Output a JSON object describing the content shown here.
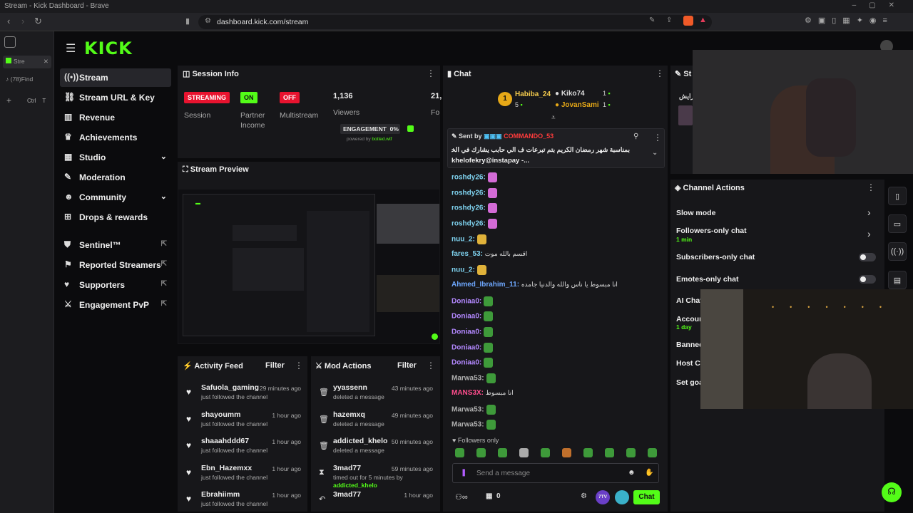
{
  "browser": {
    "title": "Stream - Kick Dashboard - Brave",
    "url": "dashboard.kick.com/stream",
    "tabs": [
      {
        "label": "Stre"
      },
      {
        "label": "(78)Find"
      }
    ],
    "tab_shortcut_a": "Ctrl",
    "tab_shortcut_b": "T"
  },
  "brand": {
    "logo": "KICK",
    "accent": "#53fc18"
  },
  "sidebar": {
    "items": [
      {
        "label": "Stream",
        "icon": "broadcast-icon"
      },
      {
        "label": "Stream URL & Key",
        "icon": "link-icon"
      },
      {
        "label": "Revenue",
        "icon": "chart-icon"
      },
      {
        "label": "Achievements",
        "icon": "trophy-icon"
      },
      {
        "label": "Studio",
        "icon": "studio-icon"
      },
      {
        "label": "Moderation",
        "icon": "wrench-icon"
      },
      {
        "label": "Community",
        "icon": "people-icon"
      },
      {
        "label": "Drops & rewards",
        "icon": "drops-icon"
      },
      {
        "label": "Sentinel™",
        "icon": "shield-icon"
      },
      {
        "label": "Reported Streamers",
        "icon": "flag-icon"
      },
      {
        "label": "Supporters",
        "icon": "heart-icon"
      },
      {
        "label": "Engagement PvP",
        "icon": "swords-icon"
      }
    ]
  },
  "session": {
    "title": "Session Info",
    "status": "STREAMING",
    "partner": "ON",
    "multistream": "OFF",
    "viewers": "1,136",
    "col5": "21,",
    "labels": {
      "session": "Session",
      "partner_a": "Partner",
      "partner_b": "Income",
      "multistream": "Multistream",
      "viewers": "Viewers",
      "col5": "Fo"
    },
    "engagement_label": "ENGAGEMENT",
    "engagement_value": "0%",
    "powered": "powered by",
    "botted": "botted.wtf"
  },
  "preview": {
    "title": "Stream Preview"
  },
  "chat": {
    "title": "Chat",
    "top_gifters": [
      {
        "rank": "1",
        "name": "Habiba_24",
        "count": "5"
      },
      {
        "name": "Kiko74",
        "count": "1"
      },
      {
        "name": "JovanSami",
        "count": "1"
      }
    ],
    "pinned": {
      "sent_by": "Sent by",
      "sender": "COMMANDO_53",
      "text": "بمناسبة شهر رمضان الكريم بتم تبرعات ف الي حابب يشارك في الخير من هنا",
      "text2": "khelofekry@instapay -..."
    },
    "messages": [
      {
        "user": "roshdy26:",
        "text": "",
        "color": "#7fd3f0"
      },
      {
        "user": "roshdy26:",
        "text": "",
        "color": "#7fd3f0"
      },
      {
        "user": "roshdy26:",
        "text": "",
        "color": "#7fd3f0"
      },
      {
        "user": "roshdy26:",
        "text": "",
        "color": "#7fd3f0"
      },
      {
        "user": "nuu_2:",
        "text": "",
        "color": "#7fd3f0"
      },
      {
        "user": "fares_53:",
        "text": "اقسم بالله موت",
        "color": "#7fd3f0"
      },
      {
        "user": "nuu_2:",
        "text": "",
        "color": "#7fd3f0"
      },
      {
        "user": "Ahmed_Ibrahim_11:",
        "text": "انا مبسوط يا ناس والله والدنيا جامده",
        "color": "#6ea8ff"
      },
      {
        "user": "Doniaa0:",
        "text": "",
        "color": "#b388ff"
      },
      {
        "user": "Doniaa0:",
        "text": "",
        "color": "#b388ff"
      },
      {
        "user": "Doniaa0:",
        "text": "",
        "color": "#b388ff"
      },
      {
        "user": "Doniaa0:",
        "text": "",
        "color": "#b388ff"
      },
      {
        "user": "Doniaa0:",
        "text": "",
        "color": "#b388ff"
      },
      {
        "user": "Marwa53:",
        "text": "",
        "color": "#b0b0b0"
      },
      {
        "user": "MANS3X:",
        "text": "انا مبسوط",
        "color": "#ff4d8d"
      },
      {
        "user": "Marwa53:",
        "text": "",
        "color": "#b0b0b0"
      },
      {
        "user": "Marwa53:",
        "text": "",
        "color": "#b0b0b0"
      }
    ],
    "followers_only": "Followers only",
    "placeholder": "Send a message",
    "count": "0",
    "send": "Chat",
    "badge_7tv": "7TV"
  },
  "activity": {
    "title": "Activity Feed",
    "filter": "Filter",
    "items": [
      {
        "name": "Safuola_gaming",
        "time": "29 minutes ago",
        "sub": "just followed the channel"
      },
      {
        "name": "shayoumm",
        "time": "1 hour ago",
        "sub": "just followed the channel"
      },
      {
        "name": "shaaahddd67",
        "time": "1 hour ago",
        "sub": "just followed the channel"
      },
      {
        "name": "Ebn_Hazemxx",
        "time": "1 hour ago",
        "sub": "just followed the channel"
      },
      {
        "name": "Ebrahiimm",
        "time": "1 hour ago",
        "sub": "just followed the channel"
      }
    ]
  },
  "mod": {
    "title": "Mod Actions",
    "filter": "Filter",
    "items": [
      {
        "name": "yyassenn",
        "time": "43 minutes ago",
        "sub": "deleted a message"
      },
      {
        "name": "hazemxq",
        "time": "49 minutes ago",
        "sub": "deleted a message"
      },
      {
        "name": "addicted_khelo",
        "time": "50 minutes ago",
        "sub": "deleted a message"
      },
      {
        "name": "3mad77",
        "time": "59 minutes ago",
        "sub": "timed out for 5 minutes by",
        "by": "addicted_khelo"
      },
      {
        "name": "3mad77",
        "time": "1 hour ago",
        "sub": ""
      }
    ]
  },
  "channel_actions": {
    "title": "Channel Actions",
    "partial_title": "St",
    "items": [
      {
        "label": "Slow mode"
      },
      {
        "label": "Followers-only chat",
        "sub": "1 min"
      },
      {
        "label": "Subscribers-only chat"
      },
      {
        "label": "Emotes-only chat"
      },
      {
        "label": "AI Chat"
      },
      {
        "label": "Accoun",
        "sub": "1 day"
      },
      {
        "label": "Banned"
      },
      {
        "label": "Host Ch"
      },
      {
        "label": "Set goa"
      }
    ]
  },
  "streams_panel_user": "رايش"
}
